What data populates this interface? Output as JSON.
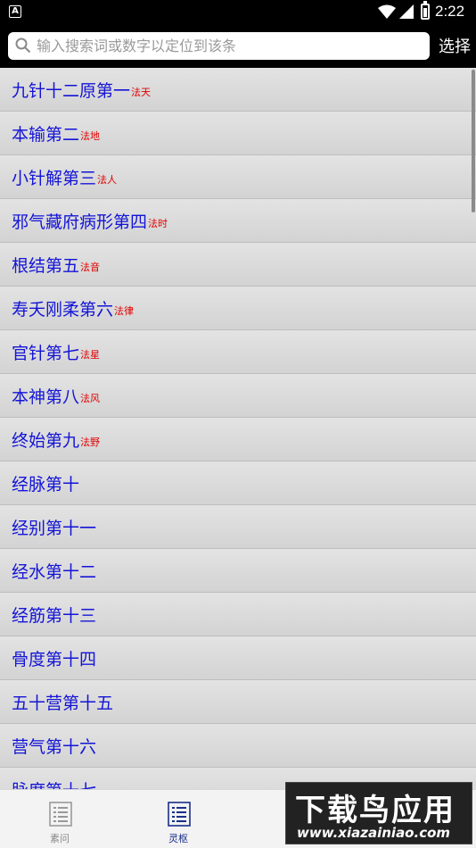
{
  "status_bar": {
    "time": "2:22",
    "app_icon_letter": "A"
  },
  "search": {
    "placeholder": "输入搜索词或数字以定位到该条",
    "select_label": "选择"
  },
  "chapters": [
    {
      "title": "九针十二原第一",
      "tag": "法天"
    },
    {
      "title": "本输第二",
      "tag": "法地"
    },
    {
      "title": "小针解第三",
      "tag": "法人"
    },
    {
      "title": "邪气藏府病形第四",
      "tag": "法时"
    },
    {
      "title": "根结第五",
      "tag": "法音"
    },
    {
      "title": "寿夭刚柔第六",
      "tag": "法律"
    },
    {
      "title": "官针第七",
      "tag": "法星"
    },
    {
      "title": "本神第八",
      "tag": "法风"
    },
    {
      "title": "终始第九",
      "tag": "法野"
    },
    {
      "title": "经脉第十",
      "tag": ""
    },
    {
      "title": "经别第十一",
      "tag": ""
    },
    {
      "title": "经水第十二",
      "tag": ""
    },
    {
      "title": "经筋第十三",
      "tag": ""
    },
    {
      "title": "骨度第十四",
      "tag": ""
    },
    {
      "title": "五十营第十五",
      "tag": ""
    },
    {
      "title": "营气第十六",
      "tag": ""
    },
    {
      "title": "脉度第十七",
      "tag": ""
    }
  ],
  "bottom_nav": [
    {
      "label": "素问",
      "icon": "list-icon",
      "active": false
    },
    {
      "label": "灵枢",
      "icon": "list-icon",
      "active": true
    }
  ],
  "watermark": {
    "logo": "下载鸟应用",
    "url": "www.xiazainiao.com"
  },
  "colors": {
    "title": "#1414d8",
    "tag": "#e00000",
    "active_nav": "#1a2f8a"
  }
}
